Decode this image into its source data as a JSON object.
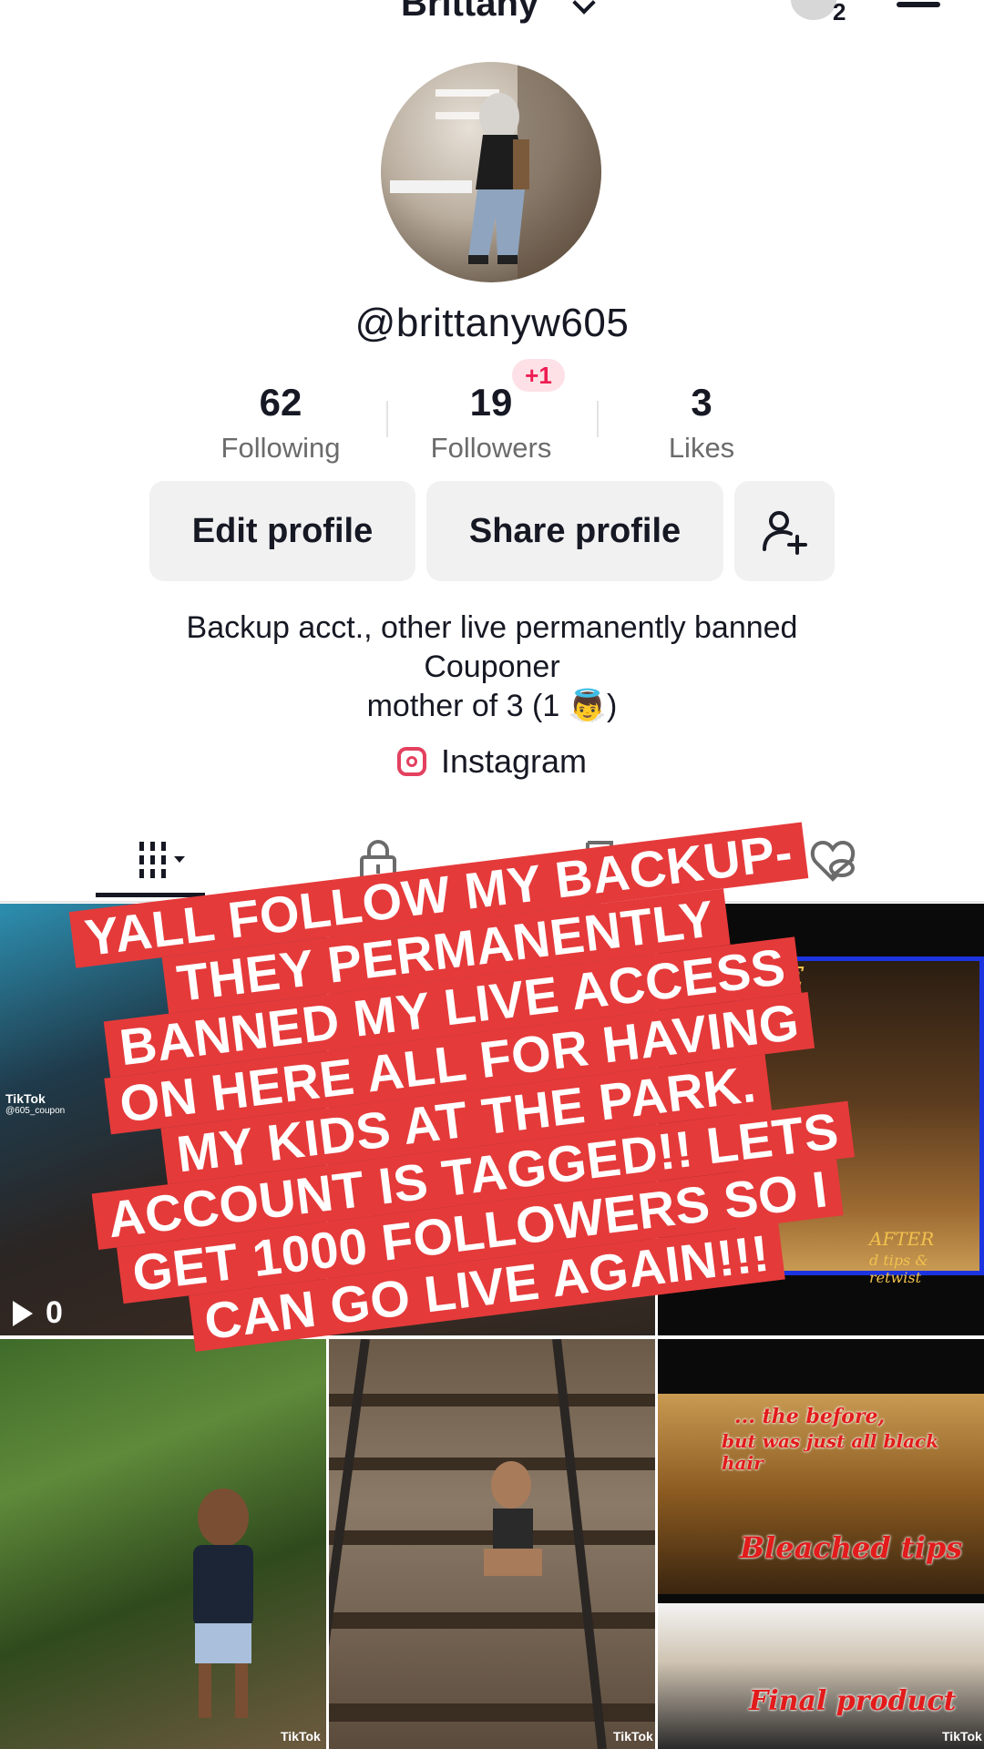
{
  "header": {
    "title": "Brittany",
    "avatar_count": "2"
  },
  "profile": {
    "username": "@brittanyw605",
    "stats": [
      {
        "value": "62",
        "label": "Following"
      },
      {
        "value": "19",
        "label": "Followers",
        "badge": "+1"
      },
      {
        "value": "3",
        "label": "Likes"
      }
    ],
    "buttons": {
      "edit": "Edit profile",
      "share": "Share profile"
    },
    "bio": [
      "Backup acct., other live permanently banned",
      "Couponer",
      "mother of 3 (1 👼)"
    ],
    "link_label": "Instagram"
  },
  "tabs": [
    "videos-grid",
    "private",
    "reposts",
    "liked"
  ],
  "grid": {
    "cell1": {
      "views": "0",
      "tt": "TikTok",
      "handle": "@605_coupon"
    },
    "cell3": {
      "tag_top": "ORE",
      "tag_after": "AFTER",
      "tag_sub": "d tips & retwist"
    },
    "cell6": {
      "cap1": "... the before,",
      "cap2": "but was just all black hair",
      "cap3": "Bleached tips",
      "cap4": "Final product"
    },
    "cell4": {
      "tt": "TikTok"
    },
    "cell5": {
      "tt": "TikTok"
    },
    "cell6_tt": "TikTok"
  },
  "overlay": {
    "lines": [
      "YALL FOLLOW MY BACKUP-",
      "THEY PERMANENTLY",
      "BANNED MY LIVE ACCESS",
      "ON HERE ALL FOR HAVING",
      "MY KIDS AT THE PARK.",
      "ACCOUNT IS TAGGED!! LETS",
      "GET 1000 FOLLOWERS SO I",
      "CAN GO LIVE AGAIN!!!"
    ],
    "color": "#e53a3a"
  }
}
